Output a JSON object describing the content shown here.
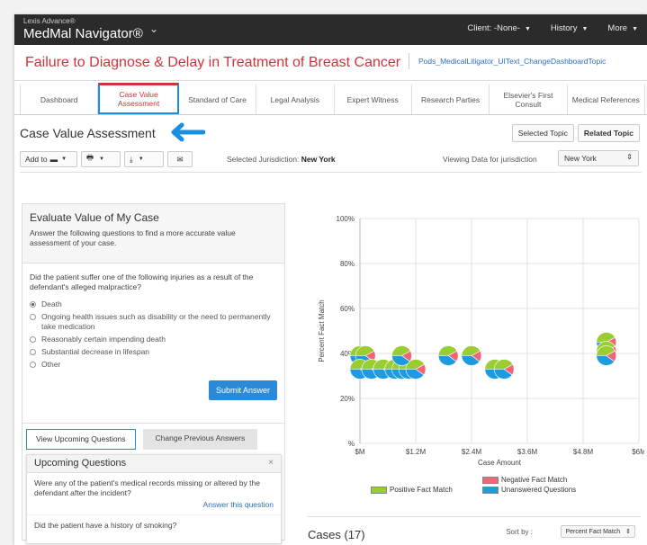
{
  "app": {
    "brand_small": "Lexis Advance®",
    "brand_name": "MedMal Navigator®"
  },
  "topnav": {
    "client": "Client: -None-",
    "history": "History",
    "more": "More"
  },
  "page": {
    "title": "Failure to Diagnose & Delay in Treatment of Breast Cancer",
    "link": "Pods_MedicalLitigator_UIText_ChangeDashboardTopic"
  },
  "tabs": [
    {
      "label": "Dashboard"
    },
    {
      "label": "Case Value Assessment"
    },
    {
      "label": "Standard of Care"
    },
    {
      "label": "Legal Analysis"
    },
    {
      "label": "Expert Witness"
    },
    {
      "label": "Research Parties"
    },
    {
      "label": "Elsevier's First Consult"
    },
    {
      "label": "Medical References"
    }
  ],
  "section": {
    "title": "Case Value Assessment",
    "selected_topic": "Selected Topic",
    "related_topic": "Related Topic"
  },
  "toolbar": {
    "add_to": "Add to",
    "jurisdiction_label": "Selected Jurisdiction:",
    "jurisdiction_value": "New York",
    "viewing_label": "Viewing Data for jurisdiction",
    "viewing_select": "New York"
  },
  "evaluate": {
    "title": "Evaluate Value of My Case",
    "description": "Answer the following questions to find a more accurate value assessment of your case.",
    "question": "Did the patient suffer one of the following injuries as a result of the defendant's alleged malpractice?",
    "options": [
      {
        "label": "Death",
        "selected": true
      },
      {
        "label": "Ongoing health issues such as disability or the need to permanently take medication",
        "selected": false
      },
      {
        "label": "Reasonably certain impending death",
        "selected": false
      },
      {
        "label": "Substantial decrease in lifespan",
        "selected": false
      },
      {
        "label": "Other",
        "selected": false
      }
    ],
    "submit": "Submit Answer",
    "view_upcoming": "View Upcoming Questions",
    "change_previous": "Change Previous Answers"
  },
  "upcoming": {
    "title": "Upcoming Questions",
    "close": "×",
    "q1": "Were any of the patient's medical records missing or altered by the defendant after the incident?",
    "answer_link": "Answer this question",
    "q2": "Did the patient have a history of smoking?"
  },
  "chart_data": {
    "type": "scatter",
    "title": "",
    "xlabel": "Case Amount",
    "ylabel": "Percent Fact Match",
    "x_ticks": [
      "$M",
      "$1.2M",
      "$2.4M",
      "$3.6M",
      "$4.8M",
      "$6M"
    ],
    "y_ticks": [
      "%",
      "20%",
      "40%",
      "60%",
      "80%",
      "100%"
    ],
    "xlim": [
      0,
      6.0
    ],
    "ylim": [
      0,
      100
    ],
    "grid": true,
    "legend_position": "bottom",
    "legend": [
      {
        "name": "Positive Fact Match",
        "color": "#9acd32"
      },
      {
        "name": "Negative Fact Match",
        "color": "#ee6677"
      },
      {
        "name": "Unanswered Questions",
        "color": "#1e9be0"
      }
    ],
    "points": [
      {
        "x": 0.0,
        "y": 39
      },
      {
        "x": 0.12,
        "y": 39
      },
      {
        "x": 0.0,
        "y": 33
      },
      {
        "x": 0.25,
        "y": 33
      },
      {
        "x": 0.5,
        "y": 33
      },
      {
        "x": 0.75,
        "y": 33
      },
      {
        "x": 0.9,
        "y": 33
      },
      {
        "x": 1.05,
        "y": 33
      },
      {
        "x": 1.2,
        "y": 33
      },
      {
        "x": 0.9,
        "y": 39
      },
      {
        "x": 1.9,
        "y": 39
      },
      {
        "x": 2.4,
        "y": 39
      },
      {
        "x": 2.9,
        "y": 33
      },
      {
        "x": 3.1,
        "y": 33
      },
      {
        "x": 5.3,
        "y": 45
      },
      {
        "x": 5.3,
        "y": 41
      },
      {
        "x": 5.3,
        "y": 39
      }
    ]
  },
  "cases": {
    "label": "Cases (17)",
    "sort_by": "Sort by :",
    "sort_value": "Percent Fact Match"
  }
}
